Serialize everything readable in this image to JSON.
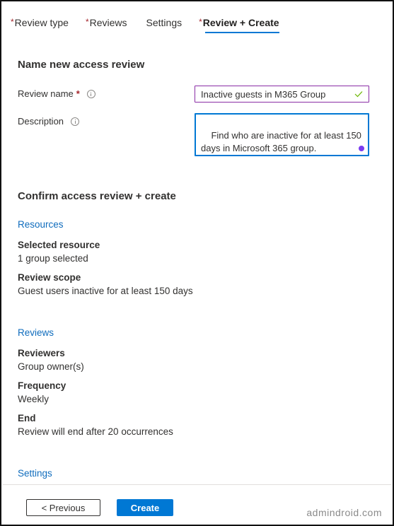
{
  "tabs": [
    {
      "label": "Review type",
      "required": "*",
      "active": false
    },
    {
      "label": "Reviews",
      "required": "*",
      "active": false
    },
    {
      "label": "Settings",
      "required": "",
      "active": false
    },
    {
      "label": "Review + Create",
      "required": "*",
      "active": true
    }
  ],
  "name_section": {
    "heading": "Name new access review",
    "review_name": {
      "label": "Review name",
      "required_marker": "*",
      "value": "Inactive guests in M365 Group",
      "status_icon": "check-icon"
    },
    "description": {
      "label": "Description",
      "value": "Find who are inactive for at least 150\ndays in Microsoft 365 group."
    }
  },
  "confirm_section": {
    "heading": "Confirm access review + create",
    "resources": {
      "link": "Resources",
      "items": [
        {
          "key": "Selected resource",
          "value": "1 group selected"
        },
        {
          "key": "Review scope",
          "value": "Guest users inactive for at least 150 days"
        }
      ]
    },
    "reviews": {
      "link": "Reviews",
      "items": [
        {
          "key": "Reviewers",
          "value": "Group owner(s)"
        },
        {
          "key": "Frequency",
          "value": "Weekly"
        },
        {
          "key": "End",
          "value": "Review will end after 20 occurrences"
        }
      ]
    },
    "settings": {
      "link": "Settings"
    }
  },
  "footer": {
    "previous_label": "< Previous",
    "create_label": "Create",
    "watermark": "admindroid.com"
  },
  "colors": {
    "accent": "#0078d4",
    "link": "#0f6cbd",
    "required": "#a4262c",
    "valid_input_border": "#8a2da5",
    "check": "#6bb700"
  }
}
